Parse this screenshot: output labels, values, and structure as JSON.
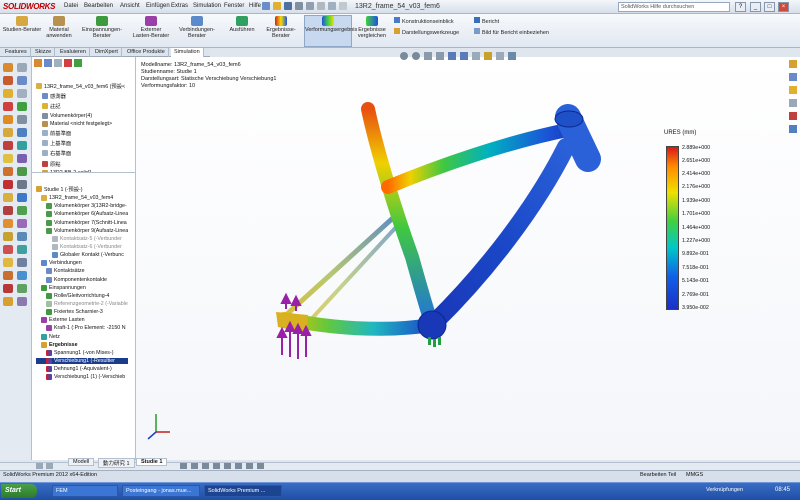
{
  "app": {
    "title": "13R2_frame_54_v03_fem6",
    "logo": "SOLIDWORKS",
    "menu": [
      "Datei",
      "Bearbeiten",
      "Ansicht",
      "Einfügen",
      "Extras",
      "Simulation",
      "Fenster",
      "Hilfe"
    ],
    "help_placeholder": "SolidWorks Hilfe durchsuchen",
    "window_buttons": [
      "?",
      "_",
      "□",
      "×"
    ]
  },
  "ribbon": {
    "buttons": [
      {
        "label": "Studien-Berater"
      },
      {
        "label": "Material anwenden"
      },
      {
        "label": "Einspannungen-Berater"
      },
      {
        "label": "Externer Lasten-Berater"
      },
      {
        "label": "Verbindungen-Berater"
      },
      {
        "label": "Ausführen"
      },
      {
        "label": "Ergebnisse-Berater"
      },
      {
        "label": "Verformungsergebnis"
      },
      {
        "label": "Ergebnisse vergleichen"
      }
    ],
    "small": [
      "Konstruktionseinblick",
      "Darstellungswerkzeuge",
      "Bericht",
      "Bild für Bericht einbeziehen"
    ]
  },
  "tabs": [
    {
      "label": "Features"
    },
    {
      "label": "Skizze"
    },
    {
      "label": "Evaluieren"
    },
    {
      "label": "DimXpert"
    },
    {
      "label": "Office Produkte"
    },
    {
      "label": "Simulation"
    }
  ],
  "tree_top": [
    {
      "label": "13R2_frame_54_v03_fem6 (預設<"
    },
    {
      "label": "感測器"
    },
    {
      "label": "註記"
    },
    {
      "label": "Volumenkörper(4)"
    },
    {
      "label": "Material <nicht festgelegt>"
    },
    {
      "label": "前基準面"
    },
    {
      "label": "上基準面"
    },
    {
      "label": "右基準面"
    },
    {
      "label": "原點"
    },
    {
      "label": "13R2-BB-2-solid1"
    }
  ],
  "tree_study": [
    {
      "label": "Studie 1 (-預設-)",
      "state": "normal"
    },
    {
      "label": "13R2_frame_54_v03_fem4",
      "state": "normal"
    },
    {
      "label": "Volumenkörper 3(13R2-bridge-",
      "state": "normal"
    },
    {
      "label": "Volumenkörper 6(Aufsatz-Linea",
      "state": "normal"
    },
    {
      "label": "Volumenkörper 7(Schnitt-Linea",
      "state": "normal"
    },
    {
      "label": "Volumenkörper 9(Aufsatz-Linea",
      "state": "normal"
    },
    {
      "label": "Kontaktsatz-5 (-Verbunder",
      "state": "grey"
    },
    {
      "label": "Kontaktsatz-6 (-Verbunder",
      "state": "grey"
    },
    {
      "label": "Globaler Kontakt (-Verbunc",
      "state": "normal"
    },
    {
      "label": "Verbindungen",
      "state": "normal"
    },
    {
      "label": "Kontaktsätze",
      "state": "normal"
    },
    {
      "label": "Komponentenkontakte",
      "state": "normal"
    },
    {
      "label": "Einspannungen",
      "state": "normal"
    },
    {
      "label": "Rolle/Gleitvorrichtung-4",
      "state": "normal"
    },
    {
      "label": "Referenzgeometrie-2 (-Variable",
      "state": "grey"
    },
    {
      "label": "Fixiertes Scharnier-3",
      "state": "normal"
    },
    {
      "label": "Externe Lasten",
      "state": "normal"
    },
    {
      "label": "Kraft-1 (:Pro Element: -2150 N",
      "state": "normal"
    },
    {
      "label": "Netz",
      "state": "normal"
    },
    {
      "label": "Ergebnisse",
      "state": "bold"
    },
    {
      "label": "Spannung1 (-von Mises-)",
      "state": "normal"
    },
    {
      "label": "Verschiebung1 (-Resultier",
      "state": "selected"
    },
    {
      "label": "Dehnung1 (-Äquivalent-)",
      "state": "normal"
    },
    {
      "label": "Verschiebung1 (1) (-Verschieb",
      "state": "normal"
    }
  ],
  "study_info": [
    "Modellname: 13R2_frame_54_v03_fem6",
    "Studienname: Studie 1",
    "Darstellungsart: Statische Verschiebung Verschiebung1",
    "Verformungsfaktor: 10"
  ],
  "legend": {
    "title": "URES (mm)",
    "labels": [
      "2.889e+000",
      "2.651e+000",
      "2.414e+000",
      "2.176e+000",
      "1.939e+000",
      "1.701e+000",
      "1.464e+000",
      "1.227e+000",
      "9.892e-001",
      "7.518e-001",
      "5.143e-001",
      "2.769e-001",
      "3.950e-002"
    ]
  },
  "bottom_tabs": [
    "Modell",
    "動力研究 1",
    "Studie 1"
  ],
  "status": {
    "left": "SolidWorks Premium 2012 x64-Edition",
    "mid": "Bearbeiten Teil",
    "units": "MMGS"
  },
  "taskbar": {
    "start": "Start",
    "items": [
      "FEM",
      "Posteingang - jonas.mue...",
      "SolidWorks Premium ..."
    ],
    "tray": "Verknüpfungen",
    "clock": "08:45"
  },
  "colors": {
    "selected": "#1a3c8c",
    "accent": "#c00000"
  }
}
